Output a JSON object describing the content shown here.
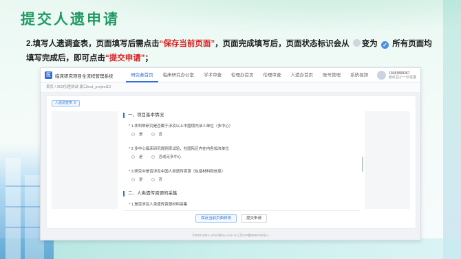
{
  "slide": {
    "title": "提交人遗申请",
    "instruction_part1": "2.填写人遗调查表，页面填写后需点击",
    "save_highlight": "“保存当前页面”",
    "instruction_part2": "，页面完成填写后，页面状态标识会从",
    "instruction_part3": "变为",
    "instruction_part4": "所有页面均填写完成后，即可点击",
    "submit_highlight": "“提交申请”",
    "instruction_part5": "；",
    "highlight_color": "#d7201f",
    "title_color": "#1f9a63"
  },
  "app": {
    "logo_icon": "hospital-logo-icon",
    "logo_glyph": "医",
    "name": "临床研究项目全流程管理系统",
    "nav": [
      {
        "label": "研究者首页"
      },
      {
        "label": "临床研究办公室"
      },
      {
        "label": "学术审查"
      },
      {
        "label": "伦理办首页"
      },
      {
        "label": "伦理审查"
      },
      {
        "label": "人遗办首页"
      },
      {
        "label": "账号管理"
      },
      {
        "label": "系统视频"
      }
    ],
    "user": {
      "phone": "13681899267",
      "role": "新红豆小一伙发展"
    },
    "breadcrumb": "首页 / 302伦理测试-家口test_project12",
    "status_chip": "人遗调查表 ⊘",
    "form": {
      "section1_title": "一、项目基本情况",
      "q1": "1.本科举研究是否属于涉及以上中国境内法人单位（多中心）",
      "q1_yes": "是",
      "q1_no": "否",
      "q2": "2.多中心临床研究规则库试验，在国际区内在内各加决单位",
      "q2_yes": "是",
      "q2_no": "否或无多中心",
      "q3": "3.研究中是否涉及中国人类遗传资源（包括材料和信息）",
      "q3_yes": "是",
      "q3_no": "否",
      "section2_title": "二、人类遗传资源的采集",
      "q4": "1.是否涉及人类遗传资源材料采集",
      "q4_yes": "是",
      "q4_no": "否"
    },
    "buttons": {
      "save": "保存当前页面修改",
      "submit": "提交申请"
    },
    "footer": "©2018-2022 urms.bjfhuu.com.cn | 京ICP备0505276号-1"
  }
}
